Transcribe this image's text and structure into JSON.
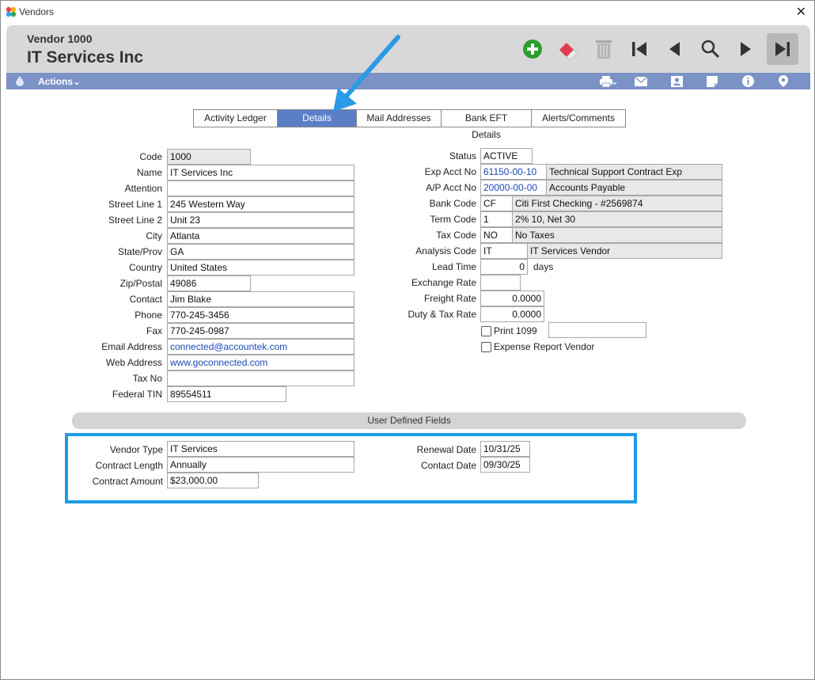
{
  "window": {
    "title": "Vendors",
    "close_glyph": "✕"
  },
  "header": {
    "vendor_label": "Vendor 1000",
    "vendor_name": "IT Services Inc"
  },
  "toolbar": {
    "icons": [
      "add-icon",
      "eraser-icon",
      "trash-icon",
      "first-record-icon",
      "previous-icon",
      "search-icon",
      "next-icon",
      "last-record-icon"
    ],
    "add_color": "#2e9e2e"
  },
  "actions_bar": {
    "label": "Actions",
    "chevron": "⌄",
    "icons": [
      "printer-icon",
      "email-icon",
      "contact-card-icon",
      "note-icon",
      "info-icon",
      "location-icon"
    ]
  },
  "tabs": [
    {
      "label": "Activity Ledger",
      "selected": false
    },
    {
      "label": "Details",
      "selected": true
    },
    {
      "label": "Mail Addresses",
      "selected": false
    },
    {
      "label": "Bank EFT Details",
      "selected": false
    },
    {
      "label": "Alerts/Comments",
      "selected": false
    }
  ],
  "left_fields": {
    "code": {
      "label": "Code",
      "value": "1000"
    },
    "name": {
      "label": "Name",
      "value": "IT Services Inc"
    },
    "attention": {
      "label": "Attention",
      "value": ""
    },
    "street1": {
      "label": "Street Line 1",
      "value": "245 Western Way"
    },
    "street2": {
      "label": "Street Line 2",
      "value": "Unit 23"
    },
    "city": {
      "label": "City",
      "value": "Atlanta"
    },
    "state": {
      "label": "State/Prov",
      "value": "GA"
    },
    "country": {
      "label": "Country",
      "value": "United States"
    },
    "zip": {
      "label": "Zip/Postal",
      "value": "49086"
    },
    "contact": {
      "label": "Contact",
      "value": "Jim Blake"
    },
    "phone": {
      "label": "Phone",
      "value": "770-245-3456"
    },
    "fax": {
      "label": "Fax",
      "value": "770-245-0987"
    },
    "email": {
      "label": "Email Address",
      "value": "connected@accountek.com"
    },
    "web": {
      "label": "Web Address",
      "value": "www.goconnected.com"
    },
    "taxno": {
      "label": "Tax No",
      "value": ""
    },
    "tin": {
      "label": "Federal TIN",
      "value": "89554511"
    }
  },
  "right_fields": {
    "status": {
      "label": "Status",
      "value": "ACTIVE"
    },
    "exp_acct": {
      "label": "Exp Acct No",
      "value": "61150-00-10",
      "desc": "Technical Support Contract Exp"
    },
    "ap_acct": {
      "label": "A/P Acct No",
      "value": "20000-00-00",
      "desc": "Accounts Payable"
    },
    "bank": {
      "label": "Bank Code",
      "value": "CF",
      "desc": "Citi First Checking - #2569874"
    },
    "term": {
      "label": "Term Code",
      "value": "1",
      "desc": "2% 10, Net 30"
    },
    "tax": {
      "label": "Tax Code",
      "value": "NO",
      "desc": "No Taxes"
    },
    "analysis": {
      "label": "Analysis Code",
      "value": "IT",
      "desc": "IT Services Vendor"
    },
    "lead": {
      "label": "Lead Time",
      "value": "0",
      "unit": "days"
    },
    "exchange": {
      "label": "Exchange Rate",
      "value": ""
    },
    "freight": {
      "label": "Freight Rate",
      "value": "0.0000"
    },
    "duty": {
      "label": "Duty & Tax Rate",
      "value": "0.0000"
    },
    "print1099": {
      "label": "Print 1099",
      "checked": false,
      "value": ""
    },
    "expense_vendor": {
      "label": "Expense Report Vendor",
      "checked": false
    }
  },
  "udf": {
    "title": "User Defined Fields",
    "vendor_type": {
      "label": "Vendor Type",
      "value": "IT Services"
    },
    "contract_length": {
      "label": "Contract Length",
      "value": "Annually"
    },
    "contract_amount": {
      "label": "Contract Amount",
      "value": "$23,000.00"
    },
    "renewal_date": {
      "label": "Renewal Date",
      "value": "10/31/25"
    },
    "contact_date": {
      "label": "Contact Date",
      "value": "09/30/25"
    }
  },
  "annotation": {
    "arrow_color": "#2a9ae6",
    "box_color": "#1e9be8"
  }
}
